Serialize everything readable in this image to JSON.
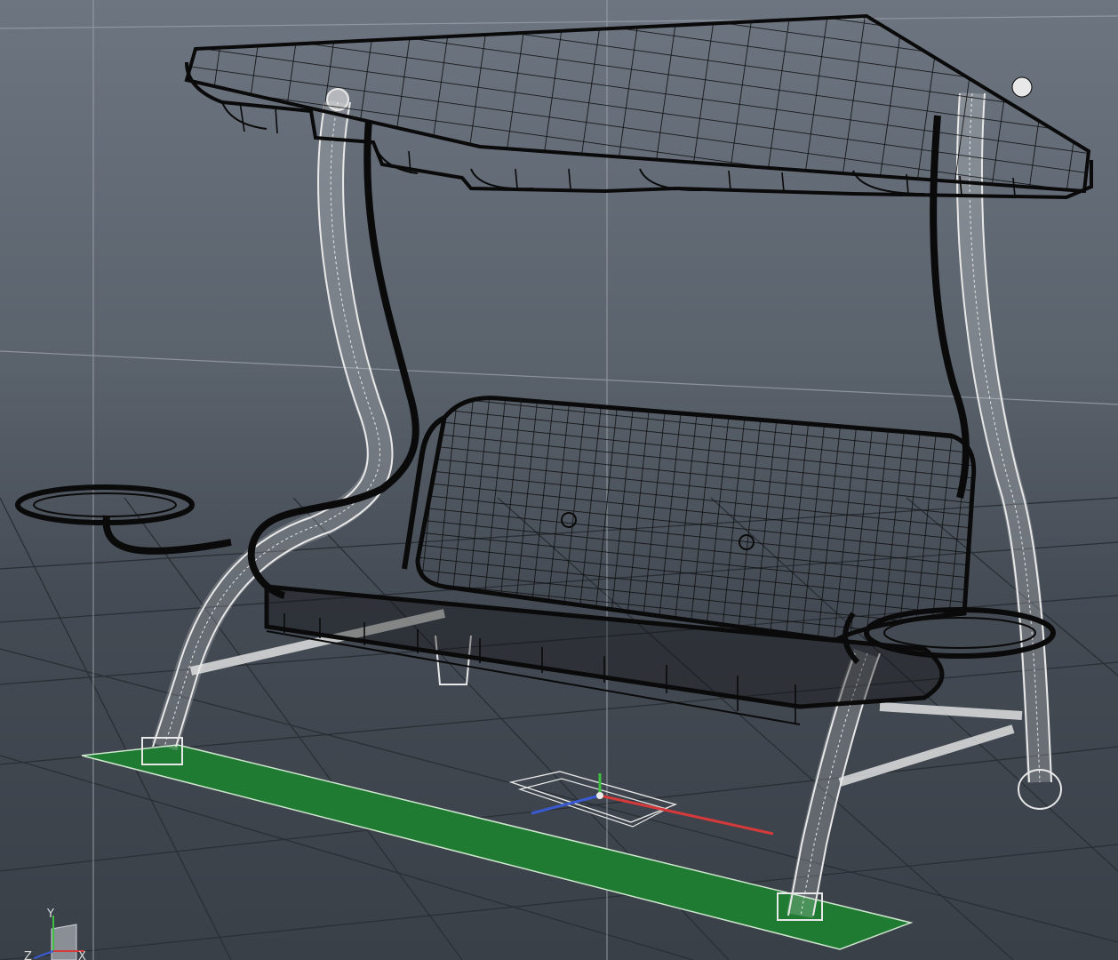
{
  "viewport": {
    "view_name": "perspective-viewport",
    "display_mode": "wireframe",
    "object": "garden-swing-bench",
    "selected_component": "swing-ground-base",
    "colors": {
      "background_top": "#6c7580",
      "background_bottom": "#3a4048",
      "grid_line": "#2a2f35",
      "grid_origin": "#9aa0a8",
      "wire_dark": "#0a0a0a",
      "wire_light": "#e8e8e8",
      "selection_fill": "#1f7a32",
      "selection_edge": "#cfe8cf",
      "axis_x": "#d43a3a",
      "axis_y": "#3fbf3f",
      "axis_z": "#3a5ad4"
    }
  },
  "axis_indicator": {
    "x_label": "X",
    "y_label": "Y",
    "z_label": "Z"
  }
}
